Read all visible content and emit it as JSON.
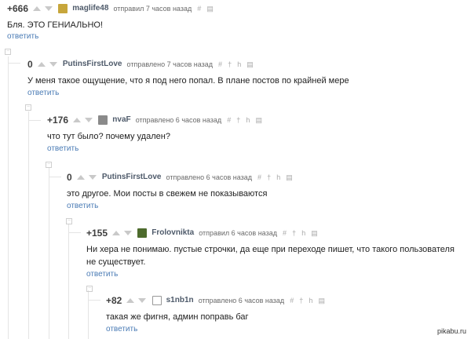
{
  "comments": [
    {
      "rating": "+666",
      "user": "maglife48",
      "meta": "отправил 7 часов назад",
      "text": "Бля. ЭТО ГЕНИАЛЬНО!",
      "reply": "ответить"
    },
    {
      "rating": "0",
      "user": "PutinsFirstLove",
      "meta": "отправлено 7 часов назад",
      "text": "У меня такое ощущение, что я под него попал. В плане постов по крайней мере",
      "reply": "ответить"
    },
    {
      "rating": "+176",
      "user": "nvaF",
      "meta": "отправлено 6 часов назад",
      "text": "что тут было? почему удален?",
      "reply": "ответить"
    },
    {
      "rating": "0",
      "user": "PutinsFirstLove",
      "meta": "отправлено 6 часов назад",
      "text": "это другое. Мои посты в свежем не показываются",
      "reply": "ответить"
    },
    {
      "rating": "+155",
      "user": "Frolovnikta",
      "meta": "отправил 6 часов назад",
      "text": "Ни хера не понимаю. пустые строчки, да еще при переходе пишет, что такого пользователя не существует.",
      "reply": "ответить"
    },
    {
      "rating": "+82",
      "user": "s1nb1n",
      "meta": "отправлено 6 часов назад",
      "text": "такая же фигня, админ поправь баг",
      "reply": "ответить"
    }
  ],
  "footer": "pikabu.ru",
  "colors": {
    "link": "#4a7bb5",
    "username": "#4e5a6a",
    "meta": "#6a6a6a"
  }
}
